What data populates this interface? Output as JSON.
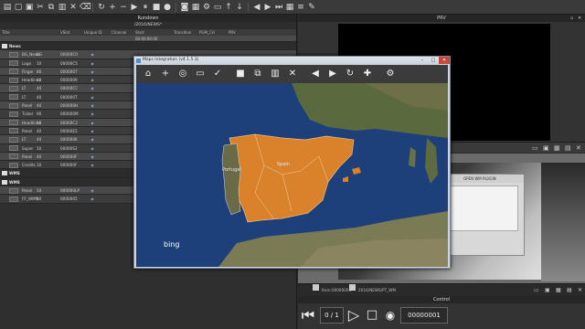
{
  "toolbar": {
    "icons": [
      "file-icon",
      "open-icon",
      "save-icon",
      "cut-icon",
      "copy-icon",
      "paste-icon",
      "delete-icon",
      "clear-icon",
      "refresh-icon",
      "add-icon",
      "remove-icon",
      "play-icon",
      "pause-icon",
      "stop-icon",
      "record-icon",
      "camera-icon",
      "print-icon",
      "settings-icon",
      "folder-icon",
      "upload-icon",
      "download-icon",
      "prev-icon",
      "next-icon",
      "end-icon",
      "grid-icon",
      "list-icon",
      "edit-icon"
    ]
  },
  "rundown": {
    "title": "Rundown",
    "path": "/2016/NEWS*",
    "columns": [
      "Title",
      "VSlot",
      "Unique ID",
      "Channel",
      "Start",
      "Transition",
      "PGM_CH",
      "PRV"
    ],
    "timecode": "00:00:00:00",
    "rows": [
      {
        "type": "group",
        "title": "News"
      },
      {
        "title": "BG_News",
        "vslot": "BG",
        "uid": "00000C0"
      },
      {
        "title": "Logo",
        "vslot": "10",
        "uid": "00000C5"
      },
      {
        "title": "Finger",
        "vslot": "80",
        "uid": "0000007"
      },
      {
        "title": "Headlines",
        "vslot": "10",
        "uid": "0000009"
      },
      {
        "title": "LT",
        "vslot": "40",
        "uid": "00000CC"
      },
      {
        "title": "LT",
        "vslot": "40",
        "uid": "000000T"
      },
      {
        "title": "Panel",
        "vslot": "40",
        "uid": "000000H"
      },
      {
        "title": "Ticker",
        "vslot": "90",
        "uid": "000000M"
      },
      {
        "title": "Headlines",
        "vslot": "10",
        "uid": "00000C2"
      },
      {
        "title": "Panel",
        "vslot": "40",
        "uid": "00000E5"
      },
      {
        "title": "LT",
        "vslot": "40",
        "uid": "000000K"
      },
      {
        "title": "Super",
        "vslot": "10",
        "uid": "00000S2"
      },
      {
        "title": "Panel",
        "vslot": "40",
        "uid": "000000F"
      },
      {
        "title": "Credits",
        "vslot": "10",
        "uid": "000000F"
      },
      {
        "type": "group",
        "title": "WMS"
      },
      {
        "type": "group",
        "title": "WMS"
      },
      {
        "title": "Panel",
        "vslot": "10",
        "uid": "000000LP"
      },
      {
        "title": "FF_WMM",
        "vslot": "10",
        "uid": "0000005"
      }
    ]
  },
  "prv": {
    "title": "PRV"
  },
  "output": {
    "dialog_title": "OPEN WM PLUGIN"
  },
  "status": {
    "item": "Item:00000001",
    "file": "2016/NEWS/PT_WM"
  },
  "control": {
    "title": "Control",
    "page": "0 / 1",
    "counter": "00000001"
  },
  "maps": {
    "title": "Maps Integration (v4.1.5.3)",
    "toolbar_icons": [
      "home-icon",
      "add-icon",
      "globe-icon",
      "folder-icon",
      "check-icon",
      "stop-icon",
      "copy-icon",
      "paste-icon",
      "close-icon",
      "prev-icon",
      "next-icon",
      "refresh-icon",
      "tools-icon",
      "settings-icon"
    ],
    "brand": "bing",
    "labels": {
      "portugal": "Portugal",
      "spain": "Spain"
    }
  }
}
